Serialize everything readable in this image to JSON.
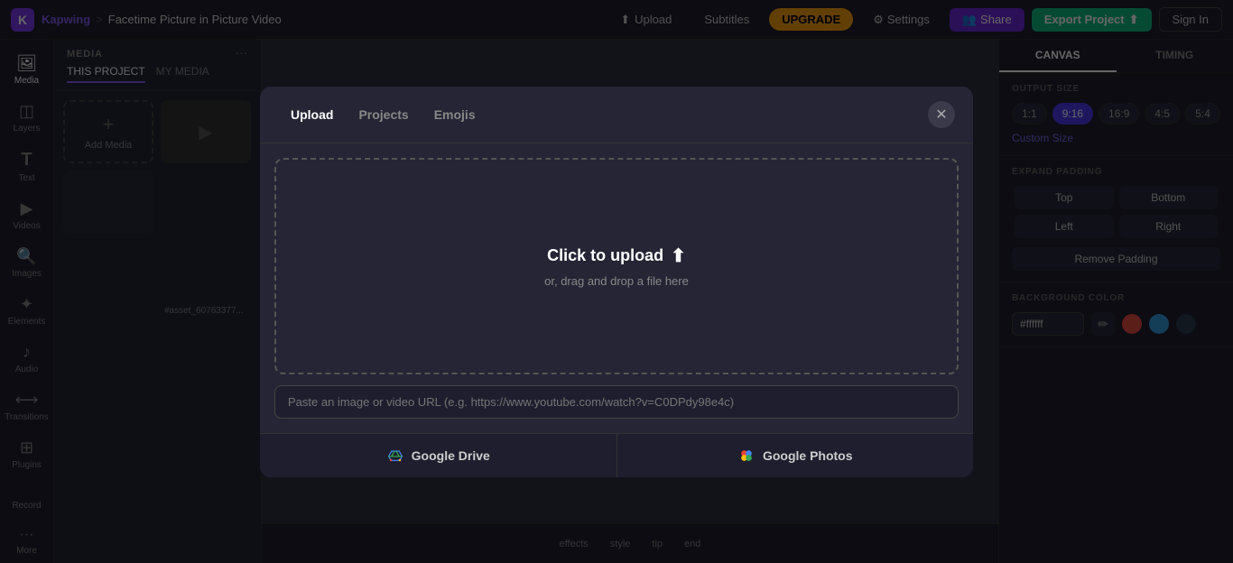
{
  "app": {
    "brand": "Kapwing",
    "separator": ">",
    "project_title": "Facetime Picture in Picture Video"
  },
  "topnav": {
    "upload_label": "Upload",
    "subtitles_label": "Subtitles",
    "upgrade_label": "UPGRADE",
    "settings_label": "Settings",
    "share_label": "Share",
    "export_label": "Export Project",
    "signin_label": "Sign In"
  },
  "sidebar": {
    "items": [
      {
        "id": "media",
        "label": "Media",
        "icon": "🖼"
      },
      {
        "id": "layers",
        "label": "Layers",
        "icon": "◫"
      },
      {
        "id": "text",
        "label": "Text",
        "icon": "T"
      },
      {
        "id": "videos",
        "label": "Videos",
        "icon": "▶"
      },
      {
        "id": "images",
        "label": "Images",
        "icon": "🔍"
      },
      {
        "id": "elements",
        "label": "Elements",
        "icon": "✦"
      },
      {
        "id": "audio",
        "label": "Audio",
        "icon": "♪"
      },
      {
        "id": "transitions",
        "label": "Transitions",
        "icon": "⟷"
      },
      {
        "id": "plugins",
        "label": "Plugins",
        "icon": "⊞"
      }
    ],
    "record_label": "Record",
    "more_label": "More"
  },
  "media_panel": {
    "title": "MEDIA",
    "tabs": [
      "THIS PROJECT",
      "MY MEDIA"
    ],
    "active_tab": "THIS PROJECT",
    "add_media_label": "Add Media",
    "filename": "#asset_60763377..."
  },
  "canvas_tabs": {
    "canvas_label": "CANVAS",
    "timing_label": "TIMING"
  },
  "right_panel": {
    "output_size_title": "OUTPUT SIZE",
    "sizes": [
      "1:1",
      "9:16",
      "16:9",
      "4:5",
      "5:4"
    ],
    "active_size": "9:16",
    "custom_size_label": "Custom Size",
    "expand_padding_title": "EXPAND PADDING",
    "padding_top": "Top",
    "padding_bottom": "Bottom",
    "padding_left": "Left",
    "padding_right": "Right",
    "remove_padding_label": "Remove Padding",
    "bg_color_title": "BACKGROUND COLOR",
    "bg_color_hex": "#ffffff",
    "swatches": [
      "#e74c3c",
      "#3498db",
      "#2c3e50"
    ]
  },
  "bottom_toolbar": {
    "items": [
      "effects",
      "style",
      "tip",
      "end"
    ]
  },
  "modal": {
    "tabs": [
      "Upload",
      "Projects",
      "Emojis"
    ],
    "active_tab": "Upload",
    "close_icon": "✕",
    "drop_zone": {
      "title": "Click to upload",
      "subtitle": "or, drag and drop a file here"
    },
    "url_placeholder": "Paste an image or video URL (e.g. https://www.youtube.com/watch?v=C0DPdy98e4c)",
    "google_drive_label": "Google Drive",
    "google_photos_label": "Google Photos"
  }
}
